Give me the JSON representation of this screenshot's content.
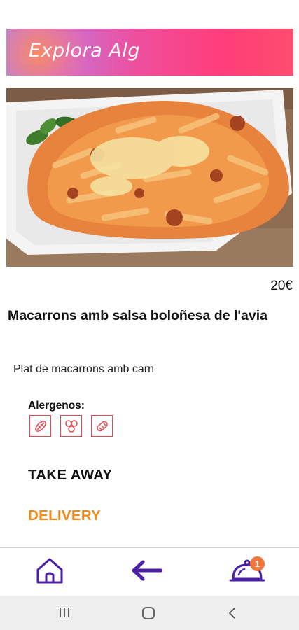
{
  "header": {
    "title": "Explora Alg"
  },
  "dish": {
    "price": "20€",
    "name": "Macarrons amb salsa boloñesa de l'avia",
    "description": "Plat de macarrons amb carn",
    "image_icon": "pasta-dish-photo"
  },
  "allergens": {
    "label": "Alergenos:",
    "icons": [
      "gluten-wheat-icon",
      "eggs-molecule-icon",
      "cereal-grain-icon"
    ]
  },
  "options": {
    "takeaway": "TAKE AWAY",
    "delivery": "DELIVERY"
  },
  "bottom_nav": {
    "home_icon": "home-icon",
    "back_icon": "back-arrow-icon",
    "orders_icon": "cloche-icon",
    "orders_badge": "1"
  },
  "colors": {
    "accent_purple": "#4b1fa6",
    "delivery_orange": "#f28a1a",
    "allergen_red": "#e24b55",
    "badge_orange": "#f0783c"
  }
}
